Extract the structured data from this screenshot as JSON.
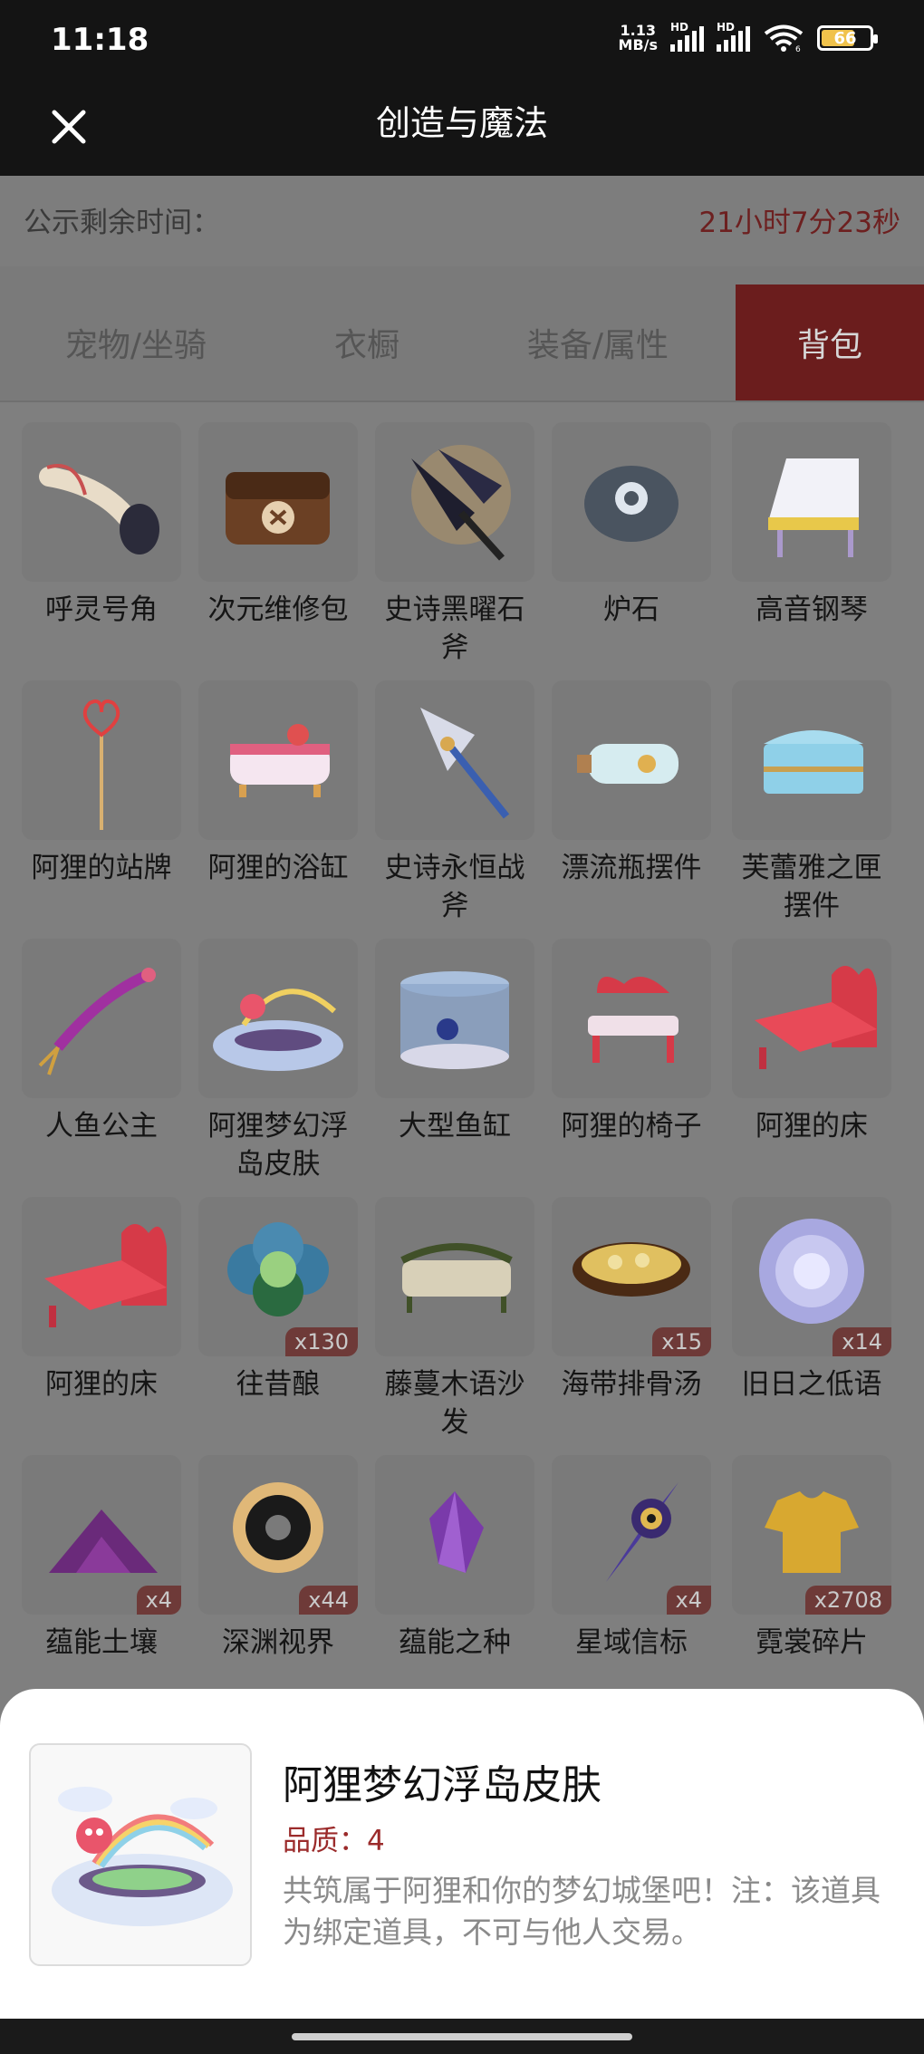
{
  "status_bar": {
    "time": "11:18",
    "net_speed_value": "1.13",
    "net_speed_unit": "MB/s",
    "signal_label": "HD",
    "battery": "66",
    "wifi_badge": "6"
  },
  "header": {
    "title": "创造与魔法",
    "close_icon": "close-icon"
  },
  "notice": {
    "label": "公示剩余时间：",
    "countdown": "21小时7分23秒"
  },
  "tabs": [
    {
      "label": "宠物/坐骑",
      "active": false
    },
    {
      "label": "衣橱",
      "active": false
    },
    {
      "label": "装备/属性",
      "active": false
    },
    {
      "label": "背包",
      "active": true
    }
  ],
  "items": [
    {
      "name": "呼灵号角",
      "icon": "horn-icon",
      "qty": ""
    },
    {
      "name": "次元维修包",
      "icon": "repair-bag-icon",
      "qty": ""
    },
    {
      "name": "史诗黑曜石斧",
      "icon": "obsidian-axe-icon",
      "qty": ""
    },
    {
      "name": "炉石",
      "icon": "hearthstone-icon",
      "qty": ""
    },
    {
      "name": "高音钢琴",
      "icon": "piano-icon",
      "qty": ""
    },
    {
      "name": "阿狸的站牌",
      "icon": "sign-icon",
      "qty": ""
    },
    {
      "name": "阿狸的浴缸",
      "icon": "bathtub-icon",
      "qty": ""
    },
    {
      "name": "史诗永恒战斧",
      "icon": "eternal-axe-icon",
      "qty": ""
    },
    {
      "name": "漂流瓶摆件",
      "icon": "bottle-icon",
      "qty": ""
    },
    {
      "name": "芙蕾雅之匣摆件",
      "icon": "chest-icon",
      "qty": ""
    },
    {
      "name": "人鱼公主",
      "icon": "mermaid-icon",
      "qty": ""
    },
    {
      "name": "阿狸梦幻浮岛皮肤",
      "icon": "floating-island-icon",
      "qty": ""
    },
    {
      "name": "大型鱼缸",
      "icon": "aquarium-icon",
      "qty": ""
    },
    {
      "name": "阿狸的椅子",
      "icon": "chair-icon",
      "qty": ""
    },
    {
      "name": "阿狸的床",
      "icon": "bed-icon",
      "qty": ""
    },
    {
      "name": "阿狸的床",
      "icon": "bed-icon",
      "qty": ""
    },
    {
      "name": "往昔酿",
      "icon": "flower-brew-icon",
      "qty": "x130"
    },
    {
      "name": "藤蔓木语沙发",
      "icon": "sofa-icon",
      "qty": ""
    },
    {
      "name": "海带排骨汤",
      "icon": "soup-icon",
      "qty": "x15"
    },
    {
      "name": "旧日之低语",
      "icon": "orb-icon",
      "qty": "x14"
    },
    {
      "name": "蕴能土壤",
      "icon": "soil-icon",
      "qty": "x4"
    },
    {
      "name": "深渊视界",
      "icon": "abyss-eye-icon",
      "qty": "x44"
    },
    {
      "name": "蕴能之种",
      "icon": "crystal-seed-icon",
      "qty": ""
    },
    {
      "name": "星域信标",
      "icon": "star-beacon-icon",
      "qty": "x4"
    },
    {
      "name": "霓裳碎片",
      "icon": "shirt-fragment-icon",
      "qty": "x2708"
    }
  ],
  "detail": {
    "title": "阿狸梦幻浮岛皮肤",
    "quality": "品质：4",
    "description": "共筑属于阿狸和你的梦幻城堡吧！注：该道具为绑定道具，不可与他人交易。",
    "icon": "floating-island-icon"
  }
}
